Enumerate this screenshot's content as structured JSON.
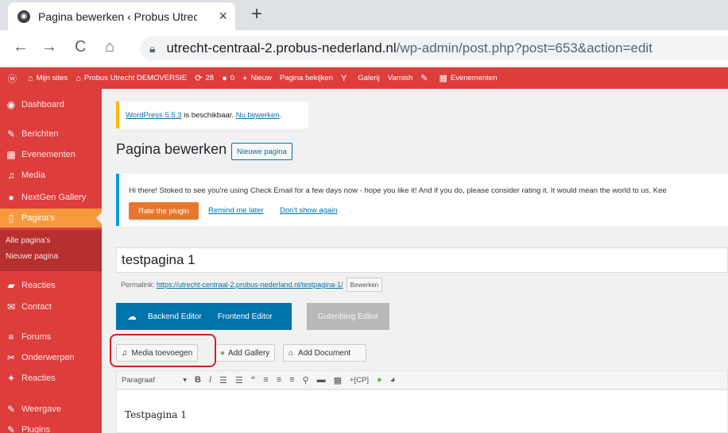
{
  "browser": {
    "tab_title": "Pagina bewerken ‹ Probus Utrech",
    "tab_close": "×",
    "new_tab": "+",
    "url_host": "utrecht-centraal-2.probus-nederland.nl",
    "url_path": "/wp-admin/post.php?post=653&action=edit",
    "nav": {
      "back": "←",
      "forward": "→",
      "reload": "C",
      "home": "⌂"
    }
  },
  "adminbar": {
    "items": [
      {
        "icon": "ⓦ",
        "label": ""
      },
      {
        "icon": "⌂",
        "label": "Mijn sites"
      },
      {
        "icon": "⌂",
        "label": "Probus Utrecht DEMOVERSIE"
      },
      {
        "icon": "⟳",
        "label": "28"
      },
      {
        "icon": "●",
        "label": "0"
      },
      {
        "icon": "+",
        "label": "Nieuw"
      },
      {
        "icon": "",
        "label": "Pagina bekijken"
      },
      {
        "icon": "Y",
        "label": ""
      },
      {
        "icon": "",
        "label": "Galerij"
      },
      {
        "icon": "",
        "label": "Varnish"
      },
      {
        "icon": "✎",
        "label": ""
      },
      {
        "icon": "▦",
        "label": "Evenementen"
      }
    ]
  },
  "sidebar": {
    "items": [
      {
        "icon": "◉",
        "label": "Dashboard"
      },
      {
        "icon": "✎",
        "label": "Berichten"
      },
      {
        "icon": "▦",
        "label": "Evenementen"
      },
      {
        "icon": "♫",
        "label": "Media"
      },
      {
        "icon": "●",
        "label": "NextGen Gallery"
      },
      {
        "icon": "▯",
        "label": "Pagina's"
      },
      {
        "icon": "▰",
        "label": "Reacties"
      },
      {
        "icon": "✉",
        "label": "Contact"
      },
      {
        "icon": "≡",
        "label": "Forums"
      },
      {
        "icon": "✂",
        "label": "Onderwerpen"
      },
      {
        "icon": "✦",
        "label": "Reacties"
      },
      {
        "icon": "✎",
        "label": "Weergave"
      },
      {
        "icon": "✎",
        "label": "Plugins"
      }
    ],
    "sub": [
      "Alle pagina's",
      "Nieuwe pagina"
    ]
  },
  "main": {
    "update_link": "WordPress 5.5.3",
    "update_text": " is beschikbaar. ",
    "update_action": "Nu bijwerken",
    "update_end": ".",
    "page_title": "Pagina bewerken",
    "new_page_button": "Nieuwe pagina",
    "email_notice": "Hi there! Stoked to see you're using Check Email for a few days now - hope you like it! And if you do, please consider rating it. It would mean the world to us. Kee",
    "rate_button": "Rate the plugin",
    "remind_link": "Remind me later",
    "dont_link": "Don't show again",
    "post_title": "testpagina 1",
    "permalink_label": "Permalink: ",
    "permalink_url": "https://utrecht-centraal-2.probus-nederland.nl/testpagina-1/",
    "permalink_edit": "Bewerken",
    "backend_editor": "Backend Editor",
    "frontend_editor": "Frontend Editor",
    "gutenberg_editor": "Gutenberg Editor",
    "media_button": "Media toevoegen",
    "gallery_button": "Add Gallery",
    "document_button": "Add Document",
    "format_select": "Paragraaf",
    "toolbar_cp": "+[CP]",
    "editor_content": "Testpagina 1"
  },
  "colors": {
    "admin_red": "#dd3d3b",
    "active_orange": "#f79a3e",
    "link_blue": "#0073aa",
    "highlight_red": "#d32020"
  }
}
